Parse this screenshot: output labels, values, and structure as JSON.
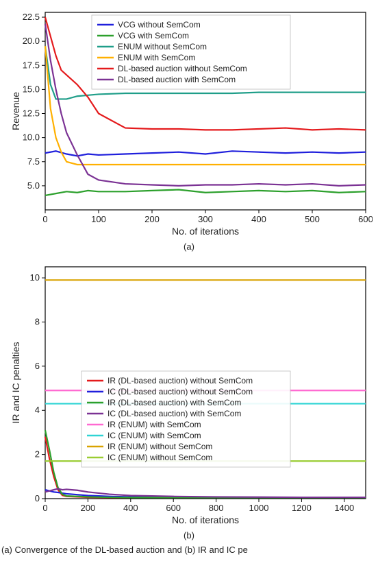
{
  "chart_data": [
    {
      "id": "a",
      "type": "line",
      "title": "",
      "xlabel": "No. of iterations",
      "ylabel": "Revenue",
      "xlim": [
        0,
        600
      ],
      "ylim": [
        2.5,
        23
      ],
      "xticks": [
        0,
        100,
        200,
        300,
        400,
        500,
        600
      ],
      "yticks": [
        5.0,
        7.5,
        10.0,
        12.5,
        15.0,
        17.5,
        20.0,
        22.5
      ],
      "ytick_labels": [
        "5.0",
        "7.5",
        "10.0",
        "12.5",
        "15.0",
        "17.5",
        "20.0",
        "22.5"
      ],
      "caption": "(a)",
      "legend_pos": "top-right",
      "series": [
        {
          "name": "VCG without SemCom",
          "color": "#1f1fdc",
          "x": [
            0,
            20,
            40,
            60,
            80,
            100,
            150,
            200,
            250,
            300,
            350,
            400,
            450,
            500,
            550,
            600
          ],
          "y": [
            8.4,
            8.6,
            8.3,
            8.1,
            8.3,
            8.2,
            8.3,
            8.4,
            8.5,
            8.3,
            8.6,
            8.5,
            8.4,
            8.5,
            8.4,
            8.5
          ]
        },
        {
          "name": "VCG with SemCom",
          "color": "#2ca02c",
          "x": [
            0,
            20,
            40,
            60,
            80,
            100,
            150,
            200,
            250,
            300,
            350,
            400,
            450,
            500,
            550,
            600
          ],
          "y": [
            4.0,
            4.2,
            4.4,
            4.3,
            4.5,
            4.4,
            4.4,
            4.5,
            4.6,
            4.3,
            4.4,
            4.5,
            4.4,
            4.5,
            4.3,
            4.4
          ]
        },
        {
          "name": "ENUM without SemCom",
          "color": "#1f9e89",
          "x": [
            0,
            10,
            20,
            30,
            40,
            60,
            80,
            100,
            150,
            200,
            250,
            300,
            350,
            400,
            450,
            500,
            550,
            600
          ],
          "y": [
            19.5,
            15.5,
            14.0,
            14.0,
            14.0,
            14.3,
            14.4,
            14.5,
            14.6,
            14.6,
            14.6,
            14.6,
            14.6,
            14.7,
            14.7,
            14.7,
            14.7,
            14.7
          ]
        },
        {
          "name": "ENUM with SemCom",
          "color": "#ffb000",
          "x": [
            0,
            10,
            20,
            30,
            40,
            60,
            80,
            100,
            150,
            200,
            250,
            300,
            350,
            400,
            450,
            500,
            550,
            600
          ],
          "y": [
            19.5,
            13.0,
            10.0,
            8.5,
            7.5,
            7.2,
            7.2,
            7.2,
            7.2,
            7.2,
            7.2,
            7.2,
            7.2,
            7.2,
            7.2,
            7.2,
            7.2,
            7.2
          ]
        },
        {
          "name": "DL-based auction without SemCom",
          "color": "#e41a1c",
          "x": [
            0,
            10,
            20,
            30,
            40,
            60,
            80,
            100,
            150,
            200,
            250,
            300,
            350,
            400,
            450,
            500,
            550,
            600
          ],
          "y": [
            22.5,
            20.5,
            18.5,
            17.0,
            16.5,
            15.5,
            14.2,
            12.5,
            11.0,
            10.9,
            10.9,
            10.8,
            10.8,
            10.9,
            11.0,
            10.8,
            10.9,
            10.8
          ]
        },
        {
          "name": "DL-based auction with SemCom",
          "color": "#7b3294",
          "x": [
            0,
            10,
            20,
            30,
            40,
            60,
            80,
            100,
            150,
            200,
            250,
            300,
            350,
            400,
            450,
            500,
            550,
            600
          ],
          "y": [
            21.8,
            18.0,
            15.0,
            12.5,
            10.5,
            8.2,
            6.2,
            5.6,
            5.2,
            5.1,
            5.0,
            5.1,
            5.1,
            5.2,
            5.1,
            5.2,
            5.0,
            5.1
          ]
        }
      ]
    },
    {
      "id": "b",
      "type": "line",
      "title": "",
      "xlabel": "No. of iterations",
      "ylabel": "IR and IC penalties",
      "xlim": [
        0,
        1500
      ],
      "ylim": [
        0,
        10.5
      ],
      "xticks": [
        0,
        200,
        400,
        600,
        800,
        1000,
        1200,
        1400
      ],
      "yticks": [
        0,
        2,
        4,
        6,
        8,
        10
      ],
      "ytick_labels": [
        "0",
        "2",
        "4",
        "6",
        "8",
        "10"
      ],
      "caption": "(b)",
      "legend_pos": "middle",
      "series": [
        {
          "name": "IR (DL-based auction) without SemCom",
          "color": "#e41a1c",
          "x": [
            0,
            20,
            40,
            60,
            80,
            100,
            150,
            200,
            300,
            400,
            600,
            800,
            1000,
            1200,
            1400,
            1500
          ],
          "y": [
            2.8,
            1.8,
            1.0,
            0.4,
            0.15,
            0.1,
            0.08,
            0.06,
            0.05,
            0.05,
            0.05,
            0.05,
            0.05,
            0.05,
            0.05,
            0.05
          ]
        },
        {
          "name": "IC (DL-based auction) without SemCom",
          "color": "#1f1fdc",
          "x": [
            0,
            20,
            40,
            60,
            80,
            100,
            150,
            200,
            300,
            400,
            600,
            800,
            1000,
            1200,
            1400,
            1500
          ],
          "y": [
            0.4,
            0.35,
            0.3,
            0.28,
            0.25,
            0.22,
            0.18,
            0.14,
            0.1,
            0.08,
            0.07,
            0.06,
            0.06,
            0.06,
            0.06,
            0.06
          ]
        },
        {
          "name": "IR (DL-based auction) with SemCom",
          "color": "#2ca02c",
          "x": [
            0,
            20,
            40,
            60,
            80,
            100,
            150,
            200,
            300,
            400,
            600,
            800,
            1000,
            1200,
            1400,
            1500
          ],
          "y": [
            3.1,
            2.2,
            1.2,
            0.5,
            0.2,
            0.12,
            0.1,
            0.08,
            0.06,
            0.05,
            0.05,
            0.05,
            0.05,
            0.05,
            0.05,
            0.05
          ]
        },
        {
          "name": "IC (DL-based auction) with SemCom",
          "color": "#7b3294",
          "x": [
            0,
            20,
            40,
            60,
            80,
            100,
            150,
            200,
            300,
            400,
            600,
            800,
            1000,
            1200,
            1400,
            1500
          ],
          "y": [
            0.3,
            0.35,
            0.4,
            0.45,
            0.4,
            0.42,
            0.38,
            0.3,
            0.2,
            0.14,
            0.1,
            0.08,
            0.07,
            0.06,
            0.06,
            0.06
          ]
        },
        {
          "name": "IR (ENUM) with SemCom",
          "color": "#ff69d1",
          "x": [
            0,
            1500
          ],
          "y": [
            4.9,
            4.9
          ]
        },
        {
          "name": "IC (ENUM) with SemCom",
          "color": "#2fd4d4",
          "x": [
            0,
            1500
          ],
          "y": [
            4.3,
            4.3
          ]
        },
        {
          "name": "IR (ENUM) without SemCom",
          "color": "#d9a300",
          "x": [
            0,
            1500
          ],
          "y": [
            9.9,
            9.9
          ]
        },
        {
          "name": "IC (ENUM) without SemCom",
          "color": "#9acd32",
          "x": [
            0,
            1500
          ],
          "y": [
            1.7,
            1.7
          ]
        }
      ]
    }
  ],
  "footer_text": "(a) Convergence of the DL-based auction and (b) IR and IC pe"
}
